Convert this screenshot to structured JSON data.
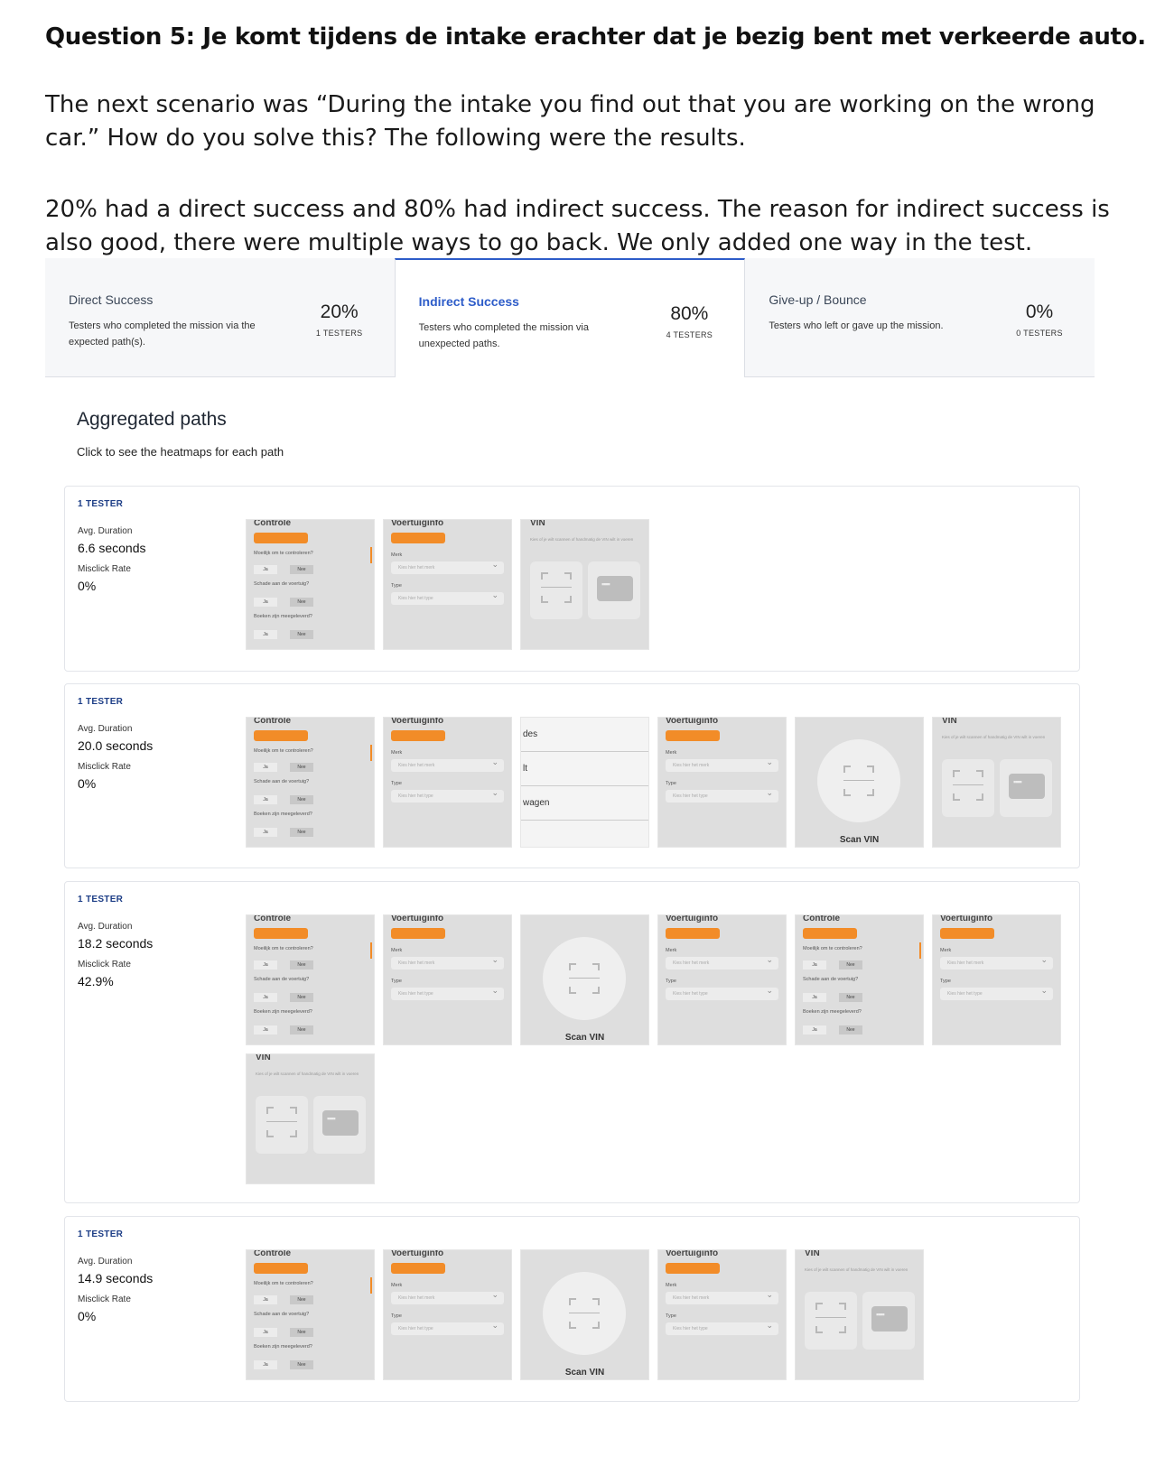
{
  "doc": {
    "question_title": "Question 5: Je komt tijdens de intake erachter dat je bezig bent met verkeerde auto.",
    "paragraph1": "The next scenario was “During the intake you find out that you are working on the wrong car.” How do you solve this? The following were the results.",
    "paragraph2": "20% had a direct success and 80% had indirect success. The reason for indirect success is also good, there were multiple ways to go back. We only added one way in the test."
  },
  "stats": [
    {
      "title": "Direct Success",
      "desc": "Testers who completed the mission via the expected path(s).",
      "pct": "20%",
      "count": "1 TESTERS"
    },
    {
      "title": "Indirect Success",
      "desc": "Testers who completed the mission via unexpected paths.",
      "pct": "80%",
      "count": "4 TESTERS"
    },
    {
      "title": "Give-up / Bounce",
      "desc": "Testers who left or gave up the mission.",
      "pct": "0%",
      "count": "0 TESTERS"
    }
  ],
  "aggregated": {
    "title": "Aggregated paths",
    "subtitle": "Click to see the heatmaps for each path"
  },
  "screens": {
    "controle": {
      "header": "Controle",
      "q1": "Moeilijk om te controleren?",
      "q2": "Schade aan de voertuig?",
      "q3": "Boeken zijn meegeleverd?",
      "yes": "Ja",
      "no": "Nee"
    },
    "voertuiginfo": {
      "header": "Voertuiginfo",
      "merk": "Merk",
      "merk_ph": "Kies hier het merk",
      "type": "Type",
      "type_ph": "Kies hier het type"
    },
    "vin": {
      "header": "VIN",
      "desc": "Kies of je wilt scannen of handmatig de VIN wilt in voeren"
    },
    "scan": {
      "label": "Scan VIN"
    },
    "brands": [
      "des",
      "lt",
      "wagen"
    ]
  },
  "paths": [
    {
      "tag": "1 TESTER",
      "duration_label": "Avg. Duration",
      "duration": "6.6 seconds",
      "misclick_label": "Misclick Rate",
      "misclick": "0%"
    },
    {
      "tag": "1 TESTER",
      "duration_label": "Avg. Duration",
      "duration": "20.0 seconds",
      "misclick_label": "Misclick Rate",
      "misclick": "0%"
    },
    {
      "tag": "1 TESTER",
      "duration_label": "Avg. Duration",
      "duration": "18.2 seconds",
      "misclick_label": "Misclick Rate",
      "misclick": "42.9%"
    },
    {
      "tag": "1 TESTER",
      "duration_label": "Avg. Duration",
      "duration": "14.9 seconds",
      "misclick_label": "Misclick Rate",
      "misclick": "0%"
    }
  ],
  "colors": {
    "accent_blue": "#2d5cc9",
    "accent_orange": "#f28c28"
  }
}
